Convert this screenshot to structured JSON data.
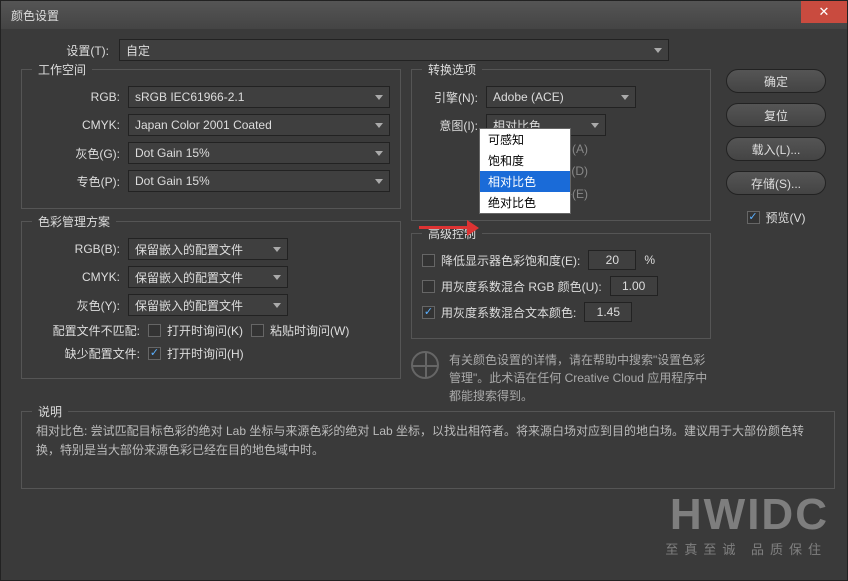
{
  "title": "颜色设置",
  "settings_label": "设置(T):",
  "settings_value": "自定",
  "workspace": {
    "legend": "工作空间",
    "rgb_label": "RGB:",
    "rgb_value": "sRGB IEC61966-2.1",
    "cmyk_label": "CMYK:",
    "cmyk_value": "Japan Color 2001 Coated",
    "gray_label": "灰色(G):",
    "gray_value": "Dot Gain 15%",
    "spot_label": "专色(P):",
    "spot_value": "Dot Gain 15%"
  },
  "policies": {
    "legend": "色彩管理方案",
    "rgb_label": "RGB(B):",
    "rgb_value": "保留嵌入的配置文件",
    "cmyk_label": "CMYK:",
    "cmyk_value": "保留嵌入的配置文件",
    "gray_label": "灰色(Y):",
    "gray_value": "保留嵌入的配置文件",
    "mismatch_label": "配置文件不匹配:",
    "mismatch_open": "打开时询问(K)",
    "mismatch_paste": "粘贴时询问(W)",
    "missing_label": "缺少配置文件:",
    "missing_open": "打开时询问(H)"
  },
  "conversion": {
    "legend": "转换选项",
    "engine_label": "引擎(N):",
    "engine_value": "Adobe (ACE)",
    "intent_label": "意图(I):",
    "intent_value": "相对比色",
    "intent_options": [
      "可感知",
      "饱和度",
      "相对比色",
      "绝对比色"
    ],
    "black_point": "(A)",
    "dither": "/通 道 图 像 )(D)",
    "scene_ref": "配置文件(E)"
  },
  "advanced": {
    "legend": "高级控制",
    "desat_label": "降低显示器色彩饱和度(E):",
    "desat_value": "20",
    "desat_unit": "%",
    "blend_rgb_label": "用灰度系数混合 RGB 颜色(U):",
    "blend_rgb_value": "1.00",
    "blend_text_label": "用灰度系数混合文本颜色:",
    "blend_text_value": "1.45"
  },
  "info_text": "有关颜色设置的详情，请在帮助中搜索\"设置色彩管理\"。此术语在任何 Creative Cloud 应用程序中都能搜索得到。",
  "desc": {
    "title": "说明",
    "text": "相对比色: 尝试匹配目标色彩的绝对 Lab 坐标与来源色彩的绝对 Lab 坐标，以找出相符者。将来源白场对应到目的地白场。建议用于大部份颜色转换，特别是当大部份来源色彩已经在目的地色域中时。"
  },
  "buttons": {
    "ok": "确定",
    "reset": "复位",
    "load": "载入(L)...",
    "save": "存储(S)...",
    "preview": "预览(V)"
  },
  "watermark": "HWIDC",
  "watermark_sub": "至真至诚 品质保住"
}
